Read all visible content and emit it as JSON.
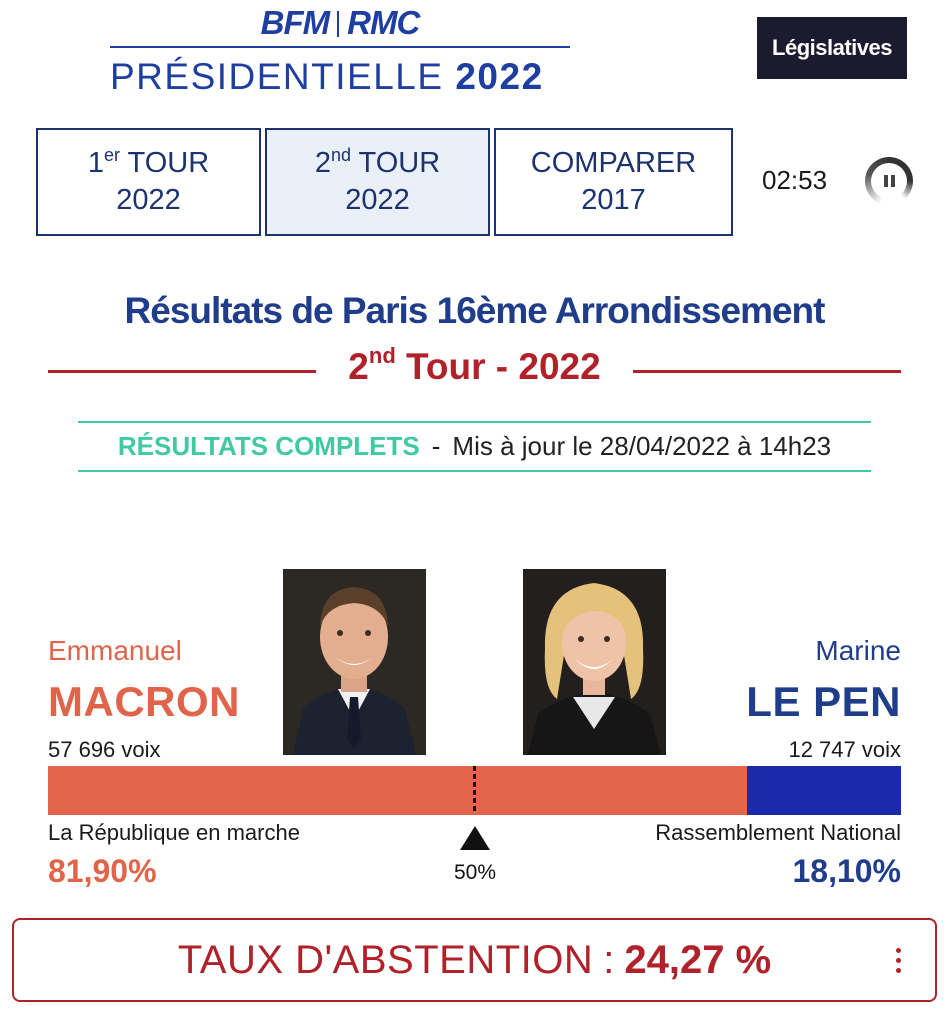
{
  "header": {
    "brand_left": "BFM",
    "brand_right": "RMC",
    "event_title": "PRÉSIDENTIELLE",
    "event_year": "2022",
    "legislatives_button": "Législatives"
  },
  "tabs": [
    {
      "line1_num": "1",
      "line1_sup": "er",
      "line1_rest": " TOUR",
      "line2": "2022",
      "active": false
    },
    {
      "line1_num": "2",
      "line1_sup": "nd",
      "line1_rest": " TOUR",
      "line2": "2022",
      "active": true
    },
    {
      "line1_num": "",
      "line1_sup": "",
      "line1_rest": "COMPARER",
      "line2": "2017",
      "active": false
    }
  ],
  "timer": "02:53",
  "results": {
    "title": "Résultats de Paris 16ème Arrondissement",
    "round_num": "2",
    "round_sup": "nd",
    "round_rest": " Tour - 2022",
    "status_complete": "RÉSULTATS COMPLETS",
    "status_dash": "-",
    "status_updated": "Mis à jour le 28/04/2022 à 14h23"
  },
  "candidates": {
    "left": {
      "first_name": "Emmanuel",
      "last_name": "MACRON",
      "votes": "57 696 voix",
      "party": "La République en marche",
      "percent": "81,90%",
      "share": 0.819,
      "color": "#e3654b"
    },
    "right": {
      "first_name": "Marine",
      "last_name": "LE PEN",
      "votes": "12 747 voix",
      "party": "Rassemblement National",
      "percent": "18,10%",
      "share": 0.181,
      "color": "#1b2aa8"
    }
  },
  "midpoint_label": "50%",
  "abstention": {
    "label": "TAUX D'ABSTENTION",
    "colon": ":",
    "value": "24,27 %"
  }
}
